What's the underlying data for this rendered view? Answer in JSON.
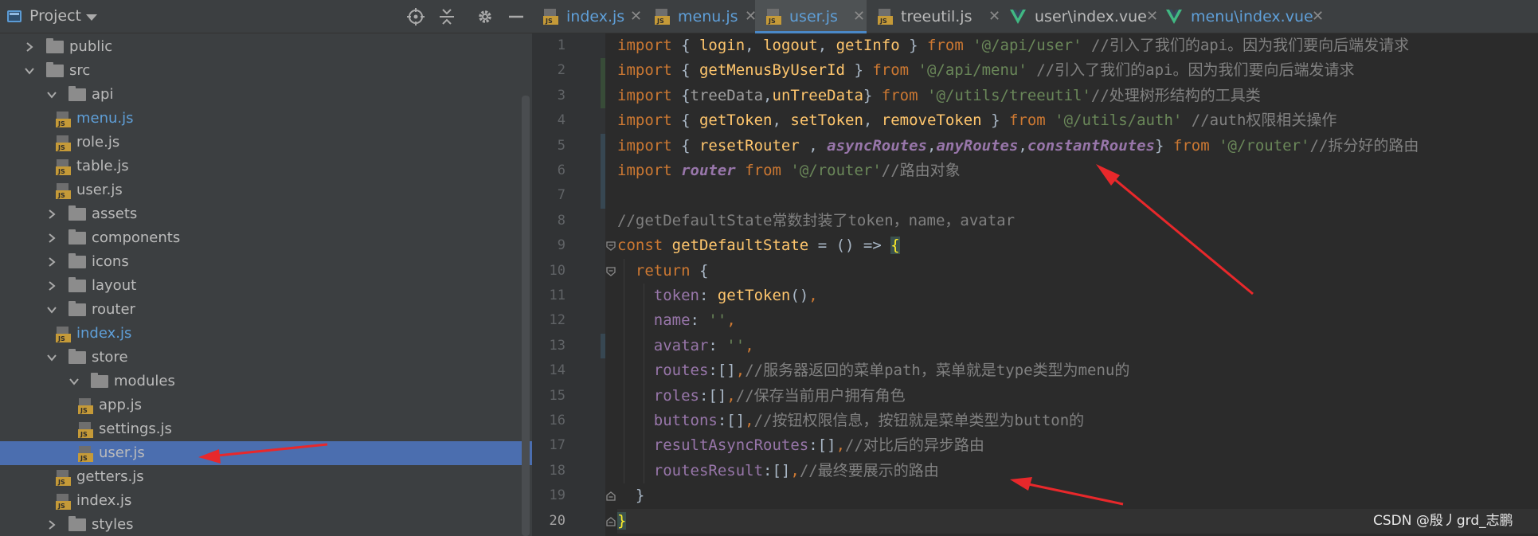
{
  "panel": {
    "title": "Project",
    "icons": [
      "locate-icon",
      "collapse-all-icon",
      "settings-gear-icon",
      "hide-icon"
    ]
  },
  "tree": [
    {
      "label": "public",
      "type": "folder",
      "level": 1,
      "expanded": false
    },
    {
      "label": "src",
      "type": "folder",
      "level": 1,
      "expanded": true
    },
    {
      "label": "api",
      "type": "folder",
      "level": 2,
      "expanded": true
    },
    {
      "label": "menu.js",
      "type": "file",
      "level": 3,
      "modified": true
    },
    {
      "label": "role.js",
      "type": "file",
      "level": 3
    },
    {
      "label": "table.js",
      "type": "file",
      "level": 3
    },
    {
      "label": "user.js",
      "type": "file",
      "level": 3
    },
    {
      "label": "assets",
      "type": "folder",
      "level": 2,
      "expanded": false
    },
    {
      "label": "components",
      "type": "folder",
      "level": 2,
      "expanded": false
    },
    {
      "label": "icons",
      "type": "folder",
      "level": 2,
      "expanded": false
    },
    {
      "label": "layout",
      "type": "folder",
      "level": 2,
      "expanded": false
    },
    {
      "label": "router",
      "type": "folder",
      "level": 2,
      "expanded": true
    },
    {
      "label": "index.js",
      "type": "file",
      "level": 3,
      "modified": true
    },
    {
      "label": "store",
      "type": "folder",
      "level": 2,
      "expanded": true
    },
    {
      "label": "modules",
      "type": "folder",
      "level": 3,
      "expanded": true
    },
    {
      "label": "app.js",
      "type": "file",
      "level": 4
    },
    {
      "label": "settings.js",
      "type": "file",
      "level": 4
    },
    {
      "label": "user.js",
      "type": "file",
      "level": 4,
      "selected": true
    },
    {
      "label": "getters.js",
      "type": "file",
      "level": 3
    },
    {
      "label": "index.js",
      "type": "file",
      "level": 3
    },
    {
      "label": "styles",
      "type": "folder",
      "level": 2,
      "expanded": false
    }
  ],
  "tabs": [
    {
      "label": "index.js",
      "icon": "js-file-icon",
      "modified": true
    },
    {
      "label": "menu.js",
      "icon": "js-file-icon",
      "modified": true
    },
    {
      "label": "user.js",
      "icon": "js-file-icon",
      "modified": true,
      "active": true
    },
    {
      "label": "treeutil.js",
      "icon": "js-file-icon",
      "modified": false
    },
    {
      "label": "user\\index.vue",
      "icon": "vue-file-icon",
      "modified": false
    },
    {
      "label": "menu\\index.vue",
      "icon": "vue-file-icon",
      "modified": true
    }
  ],
  "close_glyph": "✕",
  "code_lines": [
    {
      "n": "1",
      "tokens": [
        [
          "kw",
          "import"
        ],
        [
          "plain",
          " { "
        ],
        [
          "fn",
          "login"
        ],
        [
          "plain",
          ", "
        ],
        [
          "fn",
          "logout"
        ],
        [
          "plain",
          ", "
        ],
        [
          "fn",
          "getInfo"
        ],
        [
          "plain",
          " } "
        ],
        [
          "kw",
          "from"
        ],
        [
          "plain",
          " "
        ],
        [
          "str",
          "'@/api/user'"
        ],
        [
          "plain",
          " "
        ],
        [
          "cm",
          "//引入了我们的api。因为我们要向后端发请求"
        ]
      ]
    },
    {
      "n": "2",
      "tokens": [
        [
          "kw",
          "import"
        ],
        [
          "plain",
          " { "
        ],
        [
          "fn",
          "getMenusByUserId"
        ],
        [
          "plain",
          " } "
        ],
        [
          "kw",
          "from"
        ],
        [
          "plain",
          " "
        ],
        [
          "str",
          "'@/api/menu'"
        ],
        [
          "plain",
          " "
        ],
        [
          "cm",
          "//引入了我们的api。因为我们要向后端发请求"
        ]
      ]
    },
    {
      "n": "3",
      "tokens": [
        [
          "kw",
          "import"
        ],
        [
          "plain",
          " {"
        ],
        [
          "dim",
          "treeData"
        ],
        [
          "plain",
          ","
        ],
        [
          "fn",
          "unTreeData"
        ],
        [
          "plain",
          "} "
        ],
        [
          "kw",
          "from"
        ],
        [
          "plain",
          " "
        ],
        [
          "str",
          "'@/utils/treeutil'"
        ],
        [
          "cm",
          "//处理树形结构的工具类"
        ]
      ]
    },
    {
      "n": "4",
      "tokens": [
        [
          "kw",
          "import"
        ],
        [
          "plain",
          " { "
        ],
        [
          "fn",
          "getToken"
        ],
        [
          "plain",
          ", "
        ],
        [
          "fn",
          "setToken"
        ],
        [
          "plain",
          ", "
        ],
        [
          "fn",
          "removeToken"
        ],
        [
          "plain",
          " } "
        ],
        [
          "kw",
          "from"
        ],
        [
          "plain",
          " "
        ],
        [
          "str",
          "'@/utils/auth'"
        ],
        [
          "plain",
          " "
        ],
        [
          "cm",
          "//auth权限相关操作"
        ]
      ]
    },
    {
      "n": "5",
      "tokens": [
        [
          "kw",
          "import"
        ],
        [
          "plain",
          " { "
        ],
        [
          "fn",
          "resetRouter"
        ],
        [
          "plain",
          " , "
        ],
        [
          "ital",
          "asyncRoutes"
        ],
        [
          "plain",
          ","
        ],
        [
          "ital",
          "anyRoutes"
        ],
        [
          "plain",
          ","
        ],
        [
          "ital",
          "constantRoutes"
        ],
        [
          "plain",
          "} "
        ],
        [
          "kw",
          "from"
        ],
        [
          "plain",
          " "
        ],
        [
          "str",
          "'@/router'"
        ],
        [
          "cm",
          "//拆分好的路由"
        ]
      ]
    },
    {
      "n": "6",
      "tokens": [
        [
          "kw",
          "import"
        ],
        [
          "plain",
          " "
        ],
        [
          "ital",
          "router"
        ],
        [
          "plain",
          " "
        ],
        [
          "kw",
          "from"
        ],
        [
          "plain",
          " "
        ],
        [
          "str",
          "'@/router'"
        ],
        [
          "cm",
          "//路由对象"
        ]
      ]
    },
    {
      "n": "7",
      "tokens": []
    },
    {
      "n": "8",
      "tokens": [
        [
          "cm",
          "//getDefaultState常数封装了token，name，avatar"
        ]
      ]
    },
    {
      "n": "9",
      "tokens": [
        [
          "kw",
          "const"
        ],
        [
          "plain",
          " "
        ],
        [
          "fn",
          "getDefaultState"
        ],
        [
          "plain",
          " = () => "
        ],
        [
          "brace",
          "{"
        ]
      ]
    },
    {
      "n": "10",
      "tokens": [
        [
          "plain",
          "  "
        ],
        [
          "kw",
          "return"
        ],
        [
          "plain",
          " {"
        ]
      ]
    },
    {
      "n": "11",
      "tokens": [
        [
          "plain",
          "    "
        ],
        [
          "prop",
          "token"
        ],
        [
          "plain",
          ": "
        ],
        [
          "fn",
          "getToken"
        ],
        [
          "plain",
          "()"
        ],
        [
          "kw",
          ","
        ]
      ]
    },
    {
      "n": "12",
      "tokens": [
        [
          "plain",
          "    "
        ],
        [
          "prop",
          "name"
        ],
        [
          "plain",
          ": "
        ],
        [
          "str",
          "''"
        ],
        [
          "kw",
          ","
        ]
      ]
    },
    {
      "n": "13",
      "tokens": [
        [
          "plain",
          "    "
        ],
        [
          "prop",
          "avatar"
        ],
        [
          "plain",
          ": "
        ],
        [
          "str",
          "''"
        ],
        [
          "kw",
          ","
        ]
      ]
    },
    {
      "n": "14",
      "tokens": [
        [
          "plain",
          "    "
        ],
        [
          "prop",
          "routes"
        ],
        [
          "plain",
          ":[]"
        ],
        [
          "kw",
          ","
        ],
        [
          "cm",
          "//服务器返回的菜单path，菜单就是type类型为menu的"
        ]
      ]
    },
    {
      "n": "15",
      "tokens": [
        [
          "plain",
          "    "
        ],
        [
          "prop",
          "roles"
        ],
        [
          "plain",
          ":[]"
        ],
        [
          "kw",
          ","
        ],
        [
          "cm",
          "//保存当前用户拥有角色"
        ]
      ]
    },
    {
      "n": "16",
      "tokens": [
        [
          "plain",
          "    "
        ],
        [
          "prop",
          "buttons"
        ],
        [
          "plain",
          ":[]"
        ],
        [
          "kw",
          ","
        ],
        [
          "cm",
          "//按钮权限信息，按钮就是菜单类型为button的"
        ]
      ]
    },
    {
      "n": "17",
      "tokens": [
        [
          "plain",
          "    "
        ],
        [
          "prop",
          "resultAsyncRoutes"
        ],
        [
          "plain",
          ":[]"
        ],
        [
          "kw",
          ","
        ],
        [
          "cm",
          "//对比后的异步路由"
        ]
      ]
    },
    {
      "n": "18",
      "tokens": [
        [
          "plain",
          "    "
        ],
        [
          "prop",
          "routesResult"
        ],
        [
          "plain",
          ":[]"
        ],
        [
          "kw",
          ","
        ],
        [
          "cm",
          "//最终要展示的路由"
        ]
      ]
    },
    {
      "n": "19",
      "tokens": [
        [
          "plain",
          "  }"
        ]
      ]
    },
    {
      "n": "20",
      "tokens": [
        [
          "brace",
          "}"
        ]
      ],
      "current": true
    }
  ],
  "watermark": "CSDN @殷丿grd_志鹏",
  "colors": {
    "accent": "#4b6eaf",
    "arrow": "#e8282b"
  }
}
